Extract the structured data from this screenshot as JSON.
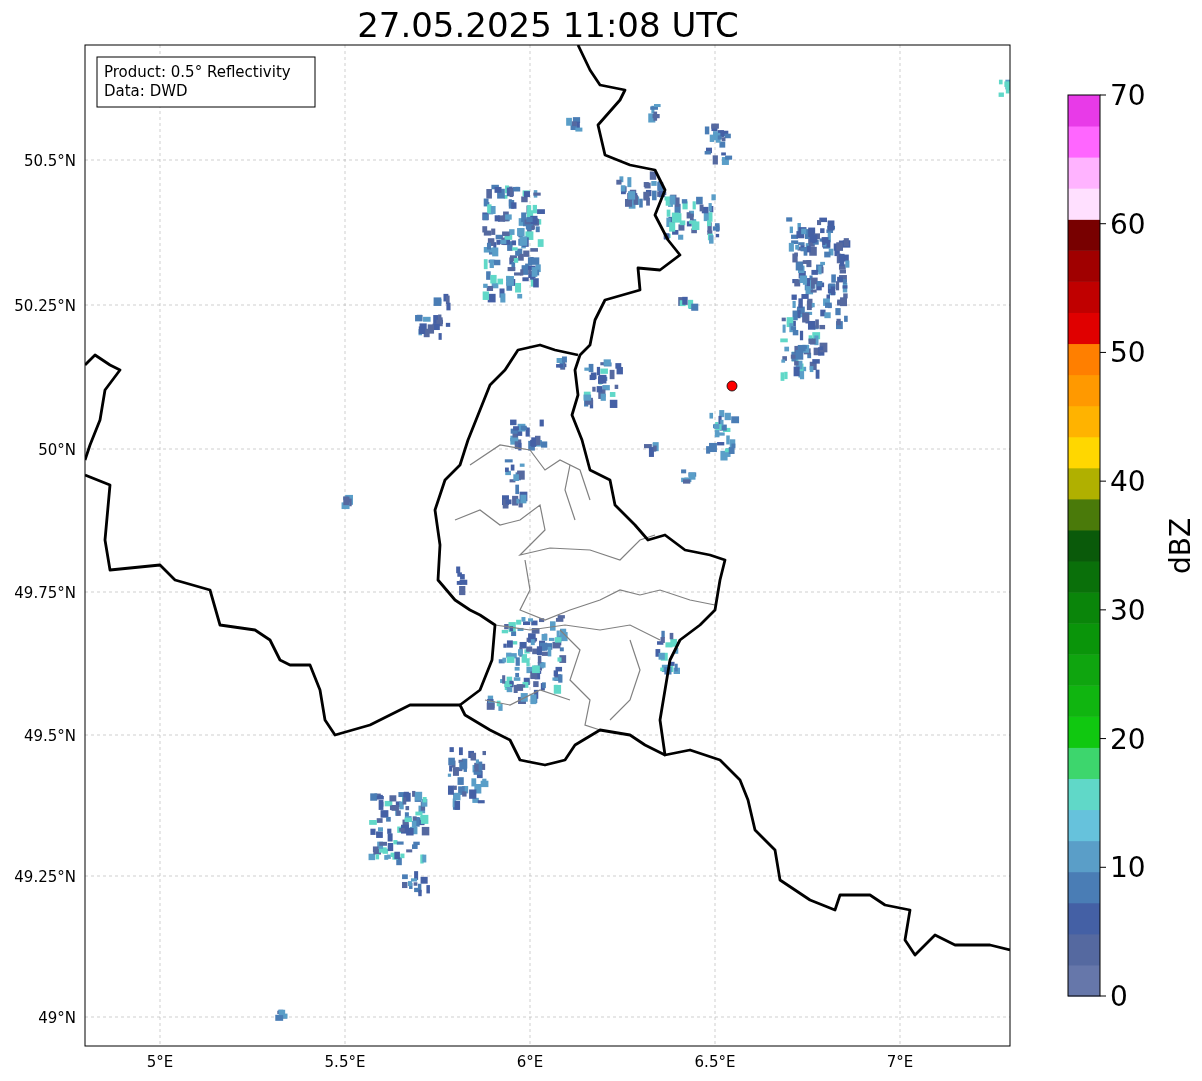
{
  "title": "27.05.2025 11:08 UTC",
  "legend": [
    "Product: 0.5° Reflectivity",
    "Data: DWD"
  ],
  "lat_ticks": [
    "50.5°N",
    "50.25°N",
    "50°N",
    "49.75°N",
    "49.5°N",
    "49.25°N",
    "49°N"
  ],
  "lon_ticks": [
    "5°E",
    "5.5°E",
    "6°E",
    "6.5°E",
    "7°E"
  ],
  "colorbar": {
    "label": "dBZ",
    "ticks": [
      "70",
      "60",
      "50",
      "40",
      "30",
      "20",
      "10",
      "0"
    ],
    "levels": [
      {
        "color": "#6677aa"
      },
      {
        "color": "#5569a0"
      },
      {
        "color": "#4460a5"
      },
      {
        "color": "#4a7db5"
      },
      {
        "color": "#5a9ec8"
      },
      {
        "color": "#66c2dc"
      },
      {
        "color": "#60d8c8"
      },
      {
        "color": "#3dd66d"
      },
      {
        "color": "#10c810"
      },
      {
        "color": "#10b510"
      },
      {
        "color": "#0fa50f"
      },
      {
        "color": "#0a950a"
      },
      {
        "color": "#0a850a"
      },
      {
        "color": "#0a700a"
      },
      {
        "color": "#0a5a0a"
      },
      {
        "color": "#4a7a0a"
      },
      {
        "color": "#b0b000"
      },
      {
        "color": "#ffd700"
      },
      {
        "color": "#ffb300"
      },
      {
        "color": "#ff9900"
      },
      {
        "color": "#ff7f00"
      },
      {
        "color": "#e00000"
      },
      {
        "color": "#c00000"
      },
      {
        "color": "#a00000"
      },
      {
        "color": "#780000"
      },
      {
        "color": "#ffe0ff"
      },
      {
        "color": "#ffb3ff"
      },
      {
        "color": "#ff66ff"
      },
      {
        "color": "#e83ae8"
      }
    ]
  }
}
